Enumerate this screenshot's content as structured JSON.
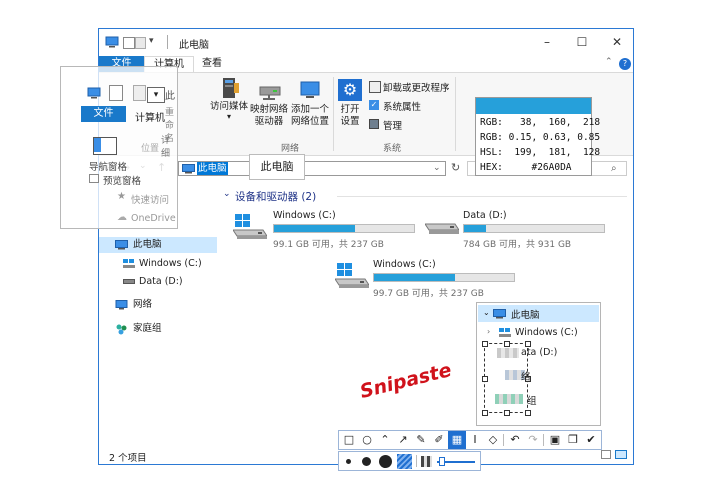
{
  "window": {
    "title": "此电脑",
    "tabs": {
      "file": "文件",
      "computer": "计算机",
      "view": "查看"
    }
  },
  "ribbon": {
    "buttons": {
      "access_media": "访问媒体",
      "map_drive_1": "映射网络",
      "map_drive_2": "驱动器",
      "add_location_1": "添加一个",
      "add_location_2": "网络位置",
      "open_settings_1": "打开",
      "open_settings_2": "设置",
      "uninstall": "卸载或更改程序",
      "system_props": "系统属性",
      "manage": "管理"
    },
    "groups": {
      "network": "网络",
      "system": "系统"
    }
  },
  "address": {
    "path": "此电脑"
  },
  "sidebar": {
    "items": [
      {
        "label": "此电脑"
      },
      {
        "label": "Windows (C:)"
      },
      {
        "label": "Data (D:)"
      },
      {
        "label": "网络"
      },
      {
        "label": "家庭组"
      }
    ]
  },
  "content": {
    "section_title": "设备和驱动器 (2)",
    "drives": [
      {
        "name": "Windows (C:)",
        "free": "99.1 GB 可用，共 237 GB",
        "used_fraction": 0.58
      },
      {
        "name": "Data (D:)",
        "free": "784 GB 可用，共 931 GB",
        "used_fraction": 0.16
      },
      {
        "name": "Windows (C:)",
        "free": "99.7 GB 可用，共 237 GB",
        "used_fraction": 0.58
      }
    ]
  },
  "status": {
    "count": "2 个项目"
  },
  "snapshot_overlay": {
    "file_tab": "文件",
    "computer_tab": "计算机",
    "title_fragment": "此",
    "rename": "重命名",
    "details": "详细",
    "location": "位置",
    "nav_pane": "导航窗格",
    "preview_pane": "预览窗格",
    "quick_access": "快速访问",
    "onedrive": "OneDrive"
  },
  "color_picker": {
    "swatch": "#26A0DA",
    "rows": [
      {
        "label": "RGB:",
        "value": "   38,  160,  218"
      },
      {
        "label": "RGB:",
        "value": " 0.15, 0.63, 0.85"
      },
      {
        "label": "HSL:",
        "value": "  199,  181,  128"
      },
      {
        "label": "HEX:",
        "value": "     #26A0DA"
      }
    ]
  },
  "tooltip": {
    "text": "此电脑"
  },
  "tree_popup": {
    "root": "此电脑",
    "child": "Windows (C:)",
    "mosaic_1": "ata (D:)",
    "mosaic_2": "络",
    "mosaic_3": "组"
  },
  "watermark": {
    "text": "Snipaste"
  },
  "colors": {
    "accent": "#1979ca",
    "drive_bar": "#26a0da",
    "selection": "#cce8ff",
    "frame": "#2b79d4",
    "watermark": "#d0121b"
  }
}
